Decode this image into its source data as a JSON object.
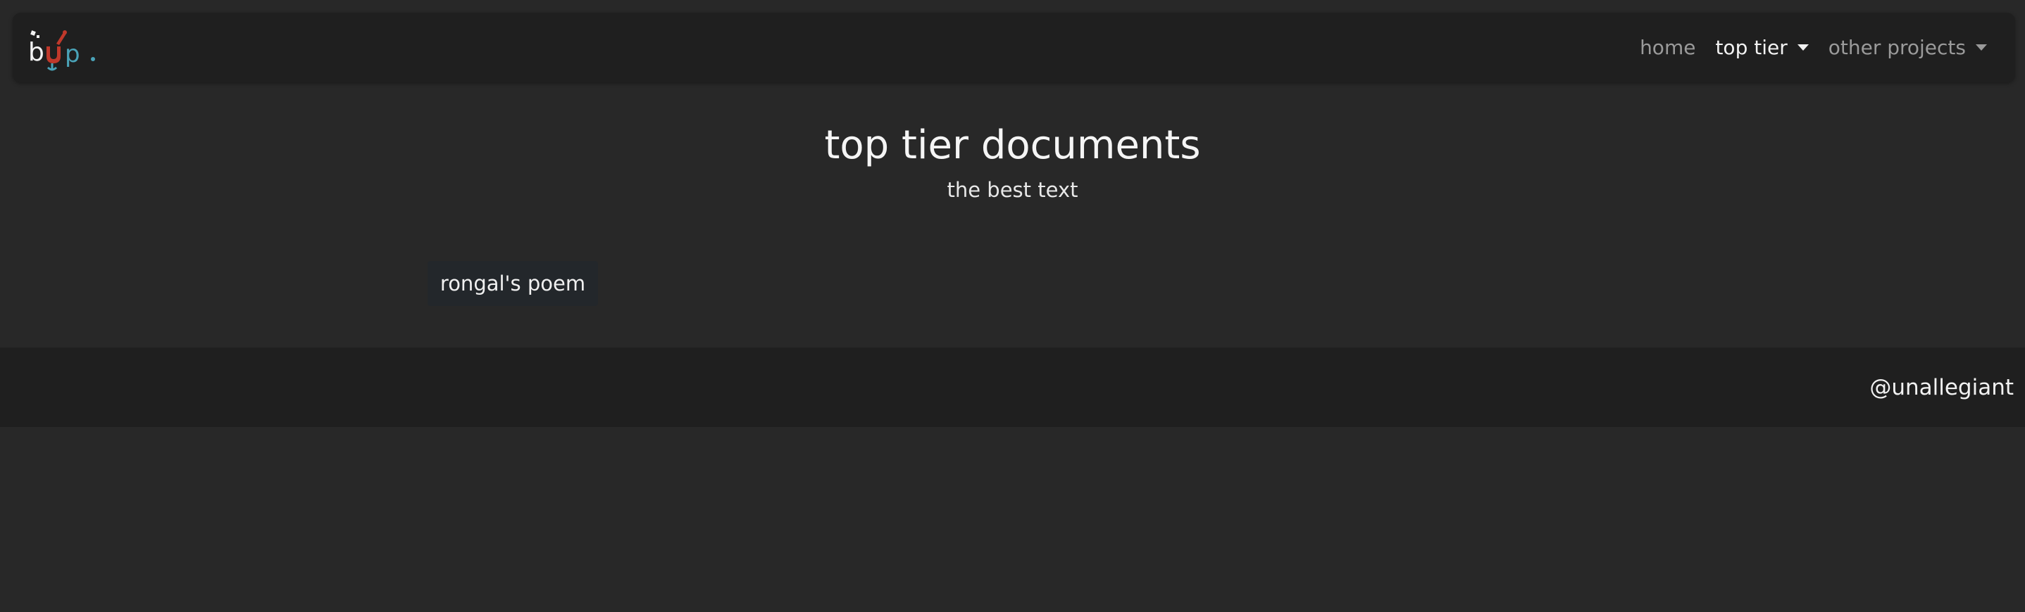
{
  "navbar": {
    "logo": {
      "text": "bup",
      "colors": {
        "b": "#f2f2f2",
        "u": "#c0392b",
        "p": "#4aa3b8",
        "dot": "#4aa3b8"
      }
    },
    "links": [
      {
        "label": "home",
        "active": false,
        "dropdown": false
      },
      {
        "label": "top tier",
        "active": true,
        "dropdown": true
      },
      {
        "label": "other projects",
        "active": false,
        "dropdown": true
      }
    ]
  },
  "header": {
    "title": "top tier documents",
    "subtitle": "the best text"
  },
  "documents": [
    {
      "label": "rongal's poem"
    }
  ],
  "footer": {
    "handle": "@unallegiant"
  },
  "colors": {
    "page_background": "#282828",
    "bar_background": "#1f1f1f",
    "button_background": "#23272b",
    "text_primary": "#f2f2f2",
    "text_muted": "#9a9a9a"
  }
}
